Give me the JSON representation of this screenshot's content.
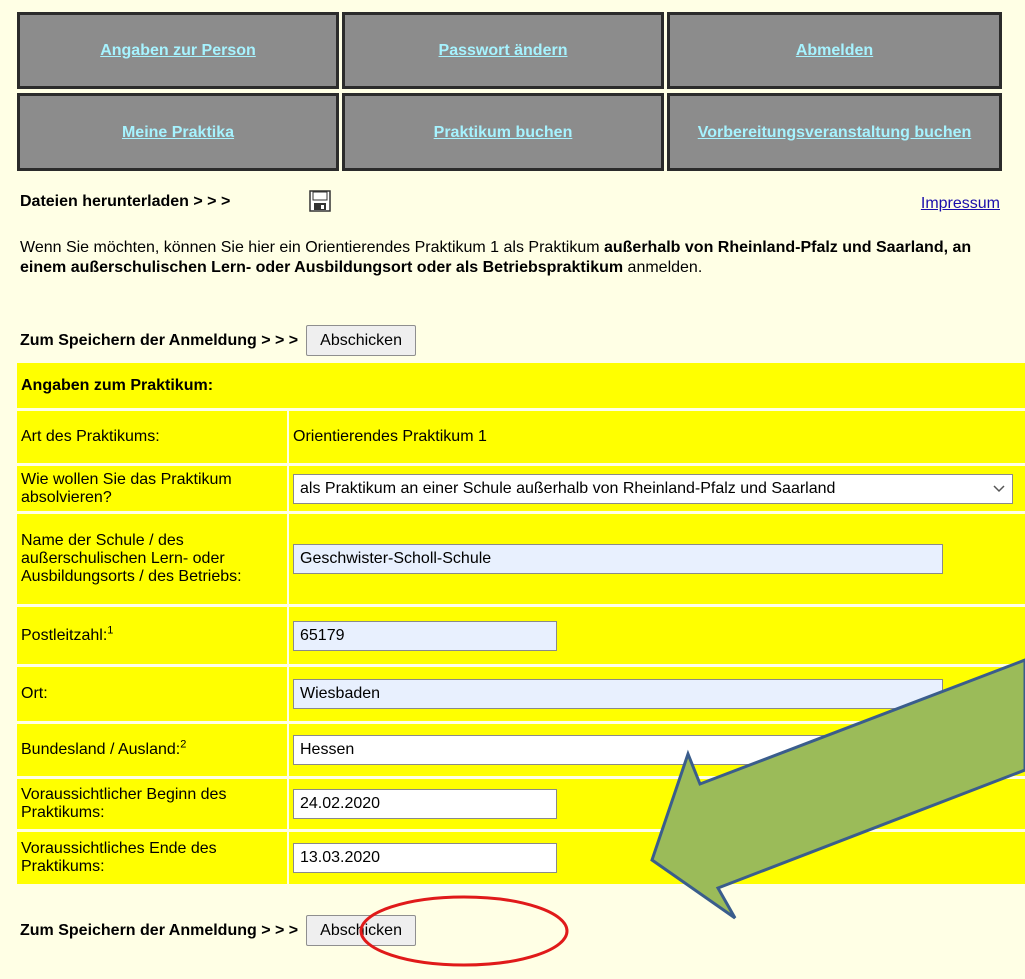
{
  "nav": {
    "items": [
      {
        "label": "Angaben zur Person"
      },
      {
        "label": "Passwort ändern"
      },
      {
        "label": "Abmelden"
      },
      {
        "label": "Meine Praktika"
      },
      {
        "label": "Praktikum buchen"
      },
      {
        "label": "Vorbereitungsveranstaltung buchen"
      }
    ]
  },
  "downloads": {
    "label": "Dateien herunterladen > > >",
    "icon": "floppy-disk-icon"
  },
  "impressum": "Impressum",
  "intro": {
    "part1": "Wenn Sie möchten, können Sie hier ein Orientierendes Praktikum 1 als Praktikum ",
    "bold": "außerhalb von Rheinland-Pfalz und Saarland, an einem außerschulischen Lern- oder Ausbildungsort oder als Betriebspraktikum",
    "part2": " anmelden."
  },
  "submit": {
    "label": "Zum Speichern der Anmeldung > > >",
    "button": "Abschicken"
  },
  "form": {
    "section_title": "Angaben zum Praktikum:",
    "art": {
      "label": "Art des Praktikums:",
      "value": "Orientierendes Praktikum 1"
    },
    "mode": {
      "label": "Wie wollen Sie das Praktikum absolvieren?",
      "value": "als Praktikum an einer Schule außerhalb von Rheinland-Pfalz und Saarland"
    },
    "school": {
      "label": "Name der Schule / des außerschulischen Lern- oder Ausbildungsorts / des Betriebs:",
      "value": "Geschwister-Scholl-Schule"
    },
    "plz": {
      "label": "Postleitzahl:",
      "sup": "1",
      "value": "65179"
    },
    "ort": {
      "label": "Ort:",
      "value": "Wiesbaden"
    },
    "land": {
      "label": "Bundesland / Ausland:",
      "sup": "2",
      "value": "Hessen"
    },
    "begin": {
      "label": "Voraussichtlicher Beginn des Praktikums:",
      "value": "24.02.2020"
    },
    "end": {
      "label": "Voraussichtliches Ende des Praktikums:",
      "value": "13.03.2020"
    }
  },
  "annotation_colors": {
    "arrow_fill": "#9bbb59",
    "arrow_stroke": "#3a5d8c",
    "circle": "#e01a1a"
  }
}
